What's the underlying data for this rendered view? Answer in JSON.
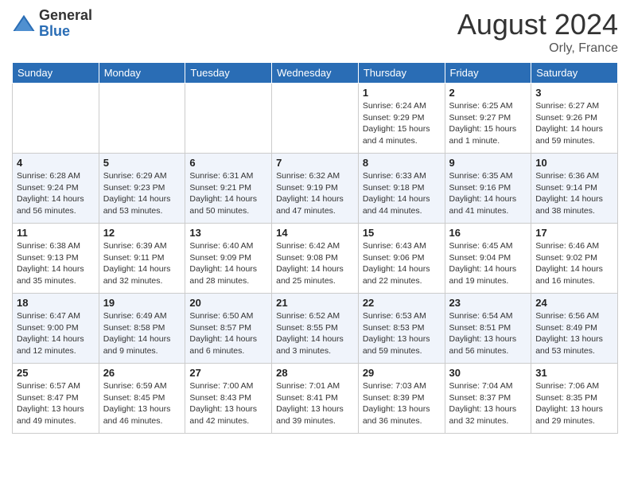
{
  "header": {
    "logo_general": "General",
    "logo_blue": "Blue",
    "month_year": "August 2024",
    "location": "Orly, France"
  },
  "weekdays": [
    "Sunday",
    "Monday",
    "Tuesday",
    "Wednesday",
    "Thursday",
    "Friday",
    "Saturday"
  ],
  "weeks": [
    [
      {
        "day": "",
        "info": ""
      },
      {
        "day": "",
        "info": ""
      },
      {
        "day": "",
        "info": ""
      },
      {
        "day": "",
        "info": ""
      },
      {
        "day": "1",
        "info": "Sunrise: 6:24 AM\nSunset: 9:29 PM\nDaylight: 15 hours\nand 4 minutes."
      },
      {
        "day": "2",
        "info": "Sunrise: 6:25 AM\nSunset: 9:27 PM\nDaylight: 15 hours\nand 1 minute."
      },
      {
        "day": "3",
        "info": "Sunrise: 6:27 AM\nSunset: 9:26 PM\nDaylight: 14 hours\nand 59 minutes."
      }
    ],
    [
      {
        "day": "4",
        "info": "Sunrise: 6:28 AM\nSunset: 9:24 PM\nDaylight: 14 hours\nand 56 minutes."
      },
      {
        "day": "5",
        "info": "Sunrise: 6:29 AM\nSunset: 9:23 PM\nDaylight: 14 hours\nand 53 minutes."
      },
      {
        "day": "6",
        "info": "Sunrise: 6:31 AM\nSunset: 9:21 PM\nDaylight: 14 hours\nand 50 minutes."
      },
      {
        "day": "7",
        "info": "Sunrise: 6:32 AM\nSunset: 9:19 PM\nDaylight: 14 hours\nand 47 minutes."
      },
      {
        "day": "8",
        "info": "Sunrise: 6:33 AM\nSunset: 9:18 PM\nDaylight: 14 hours\nand 44 minutes."
      },
      {
        "day": "9",
        "info": "Sunrise: 6:35 AM\nSunset: 9:16 PM\nDaylight: 14 hours\nand 41 minutes."
      },
      {
        "day": "10",
        "info": "Sunrise: 6:36 AM\nSunset: 9:14 PM\nDaylight: 14 hours\nand 38 minutes."
      }
    ],
    [
      {
        "day": "11",
        "info": "Sunrise: 6:38 AM\nSunset: 9:13 PM\nDaylight: 14 hours\nand 35 minutes."
      },
      {
        "day": "12",
        "info": "Sunrise: 6:39 AM\nSunset: 9:11 PM\nDaylight: 14 hours\nand 32 minutes."
      },
      {
        "day": "13",
        "info": "Sunrise: 6:40 AM\nSunset: 9:09 PM\nDaylight: 14 hours\nand 28 minutes."
      },
      {
        "day": "14",
        "info": "Sunrise: 6:42 AM\nSunset: 9:08 PM\nDaylight: 14 hours\nand 25 minutes."
      },
      {
        "day": "15",
        "info": "Sunrise: 6:43 AM\nSunset: 9:06 PM\nDaylight: 14 hours\nand 22 minutes."
      },
      {
        "day": "16",
        "info": "Sunrise: 6:45 AM\nSunset: 9:04 PM\nDaylight: 14 hours\nand 19 minutes."
      },
      {
        "day": "17",
        "info": "Sunrise: 6:46 AM\nSunset: 9:02 PM\nDaylight: 14 hours\nand 16 minutes."
      }
    ],
    [
      {
        "day": "18",
        "info": "Sunrise: 6:47 AM\nSunset: 9:00 PM\nDaylight: 14 hours\nand 12 minutes."
      },
      {
        "day": "19",
        "info": "Sunrise: 6:49 AM\nSunset: 8:58 PM\nDaylight: 14 hours\nand 9 minutes."
      },
      {
        "day": "20",
        "info": "Sunrise: 6:50 AM\nSunset: 8:57 PM\nDaylight: 14 hours\nand 6 minutes."
      },
      {
        "day": "21",
        "info": "Sunrise: 6:52 AM\nSunset: 8:55 PM\nDaylight: 14 hours\nand 3 minutes."
      },
      {
        "day": "22",
        "info": "Sunrise: 6:53 AM\nSunset: 8:53 PM\nDaylight: 13 hours\nand 59 minutes."
      },
      {
        "day": "23",
        "info": "Sunrise: 6:54 AM\nSunset: 8:51 PM\nDaylight: 13 hours\nand 56 minutes."
      },
      {
        "day": "24",
        "info": "Sunrise: 6:56 AM\nSunset: 8:49 PM\nDaylight: 13 hours\nand 53 minutes."
      }
    ],
    [
      {
        "day": "25",
        "info": "Sunrise: 6:57 AM\nSunset: 8:47 PM\nDaylight: 13 hours\nand 49 minutes."
      },
      {
        "day": "26",
        "info": "Sunrise: 6:59 AM\nSunset: 8:45 PM\nDaylight: 13 hours\nand 46 minutes."
      },
      {
        "day": "27",
        "info": "Sunrise: 7:00 AM\nSunset: 8:43 PM\nDaylight: 13 hours\nand 42 minutes."
      },
      {
        "day": "28",
        "info": "Sunrise: 7:01 AM\nSunset: 8:41 PM\nDaylight: 13 hours\nand 39 minutes."
      },
      {
        "day": "29",
        "info": "Sunrise: 7:03 AM\nSunset: 8:39 PM\nDaylight: 13 hours\nand 36 minutes."
      },
      {
        "day": "30",
        "info": "Sunrise: 7:04 AM\nSunset: 8:37 PM\nDaylight: 13 hours\nand 32 minutes."
      },
      {
        "day": "31",
        "info": "Sunrise: 7:06 AM\nSunset: 8:35 PM\nDaylight: 13 hours\nand 29 minutes."
      }
    ]
  ]
}
